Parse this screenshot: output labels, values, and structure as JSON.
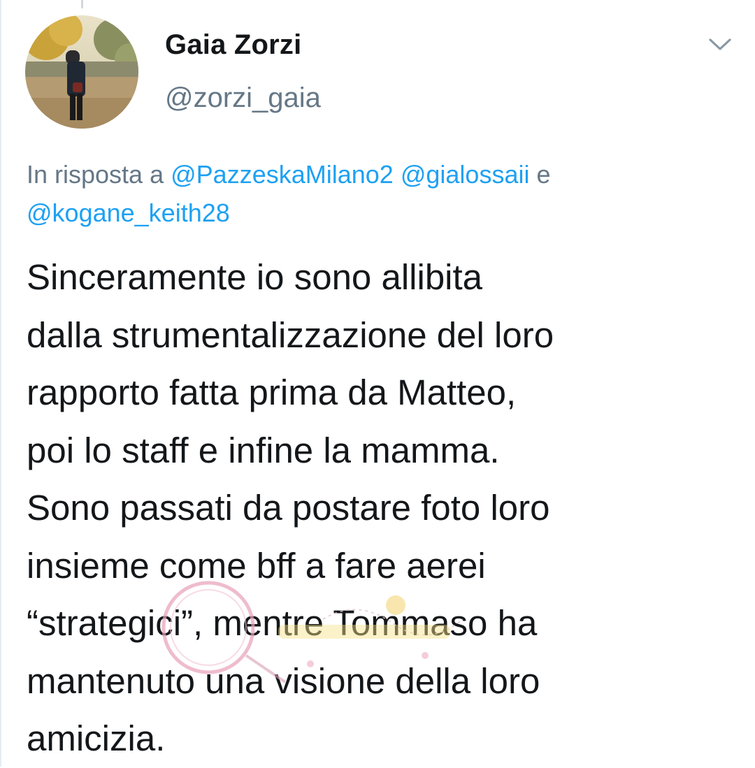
{
  "tweet": {
    "author": {
      "display_name": "Gaia Zorzi",
      "handle": "@zorzi_gaia",
      "avatar_icon": "avatar-photo"
    },
    "menu_icon": "chevron-down-icon",
    "reply_context": {
      "prefix": "In risposta a",
      "mentions": [
        "@PazzeskaMilano2",
        "@gialossaii",
        "@kogane_keith28"
      ],
      "conjunction": "e"
    },
    "text": "Sinceramente io sono allibita\ndalla strumentalizzazione del loro\nrapporto fatta prima da Matteo,\npoi lo staff e infine la mamma.\nSono passati da postare foto loro\ninsieme come bff a fare aerei\n“strategici”, mentre Tommaso ha\nmantenuto una visione della loro\namicizia."
  },
  "watermark": {
    "icon": "watermark-logo"
  },
  "colors": {
    "text_primary": "#14171a",
    "text_secondary": "#657786",
    "link": "#1da1f2"
  }
}
